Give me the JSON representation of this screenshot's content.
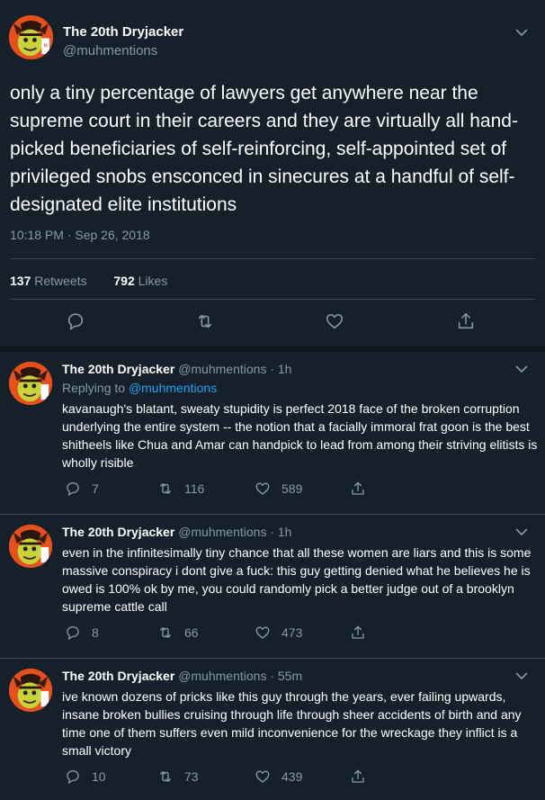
{
  "main": {
    "name": "The 20th Dryjacker",
    "handle": "@muhmentions",
    "text": "only a tiny percentage of lawyers get anywhere near the supreme court in their careers and they are virtually all hand-picked beneficiaries of self-reinforcing, self-appointed set of privileged snobs ensconced in sinecures at a handful of self-designated elite institutions",
    "timestamp": "10:18 PM · Sep 26, 2018",
    "retweets_count": "137",
    "retweets_label": "Retweets",
    "likes_count": "792",
    "likes_label": "Likes"
  },
  "replies": [
    {
      "name": "The 20th Dryjacker",
      "handle": "@muhmentions · 1h",
      "replying_prefix": "Replying to",
      "replying_to": "@muhmentions",
      "text": "kavanaugh's blatant, sweaty stupidity is perfect 2018 face of the broken corruption underlying the entire system -- the notion that a facially immoral frat goon is the best shitheels like Chua and Amar can handpick to lead from among their striving elitists is wholly risible",
      "replies": "7",
      "retweets": "116",
      "likes": "589"
    },
    {
      "name": "The 20th Dryjacker",
      "handle": "@muhmentions · 1h",
      "text": "even in the infinitesimally tiny chance that all these women are liars and this is some massive conspiracy i dont give a fuck: this guy getting denied what he believes he is owed is 100% ok by me, you could randomly pick a better judge out of a brooklyn supreme cattle call",
      "replies": "8",
      "retweets": "66",
      "likes": "473"
    },
    {
      "name": "The 20th Dryjacker",
      "handle": "@muhmentions · 55m",
      "text": "ive known dozens of pricks like this guy through the years, ever failing upwards, insane broken bullies cruising through life through sheer accidents of birth and any time one of them suffers even mild inconvenience for the wreckage they inflict is a small victory",
      "replies": "10",
      "retweets": "73",
      "likes": "439"
    }
  ],
  "colors": {
    "background": "#15202b",
    "secondary_text": "#8899a6",
    "link": "#1da1f2",
    "avatar_bg": "#e8501b"
  },
  "icons": [
    "chevron-down-icon",
    "reply-icon",
    "retweet-icon",
    "like-icon",
    "share-icon"
  ]
}
